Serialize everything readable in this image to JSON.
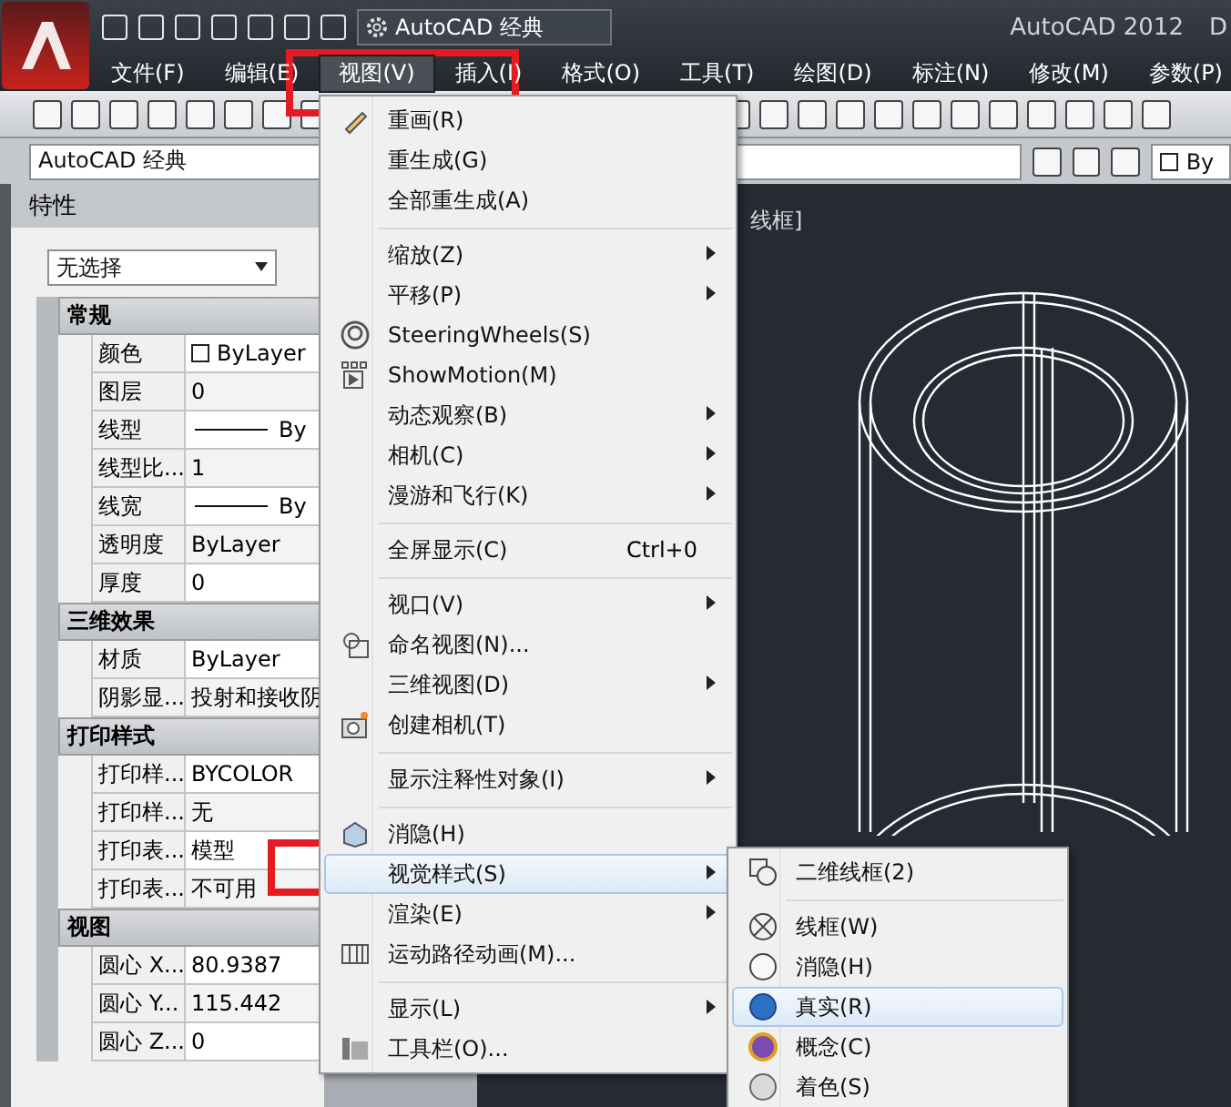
{
  "title_bar": {
    "workspace": "AutoCAD 经典",
    "app_title": "AutoCAD 2012",
    "cut_text": "D"
  },
  "menu_bar": [
    {
      "label": "文件(F)",
      "selected": false
    },
    {
      "label": "编辑(E)",
      "selected": false
    },
    {
      "label": "视图(V)",
      "selected": true
    },
    {
      "label": "插入(I)",
      "selected": false
    },
    {
      "label": "格式(O)",
      "selected": false
    },
    {
      "label": "工具(T)",
      "selected": false
    },
    {
      "label": "绘图(D)",
      "selected": false
    },
    {
      "label": "标注(N)",
      "selected": false
    },
    {
      "label": "修改(M)",
      "selected": false
    },
    {
      "label": "参数(P)",
      "selected": false
    }
  ],
  "workspace_bar": {
    "workspace": "AutoCAD 经典",
    "layer_value": "By"
  },
  "properties": {
    "title": "特性",
    "selection": "无选择",
    "sections": [
      {
        "title": "常规",
        "rows": [
          {
            "label": "颜色",
            "value": "ByLayer",
            "kind": "swatch"
          },
          {
            "label": "图层",
            "value": "0",
            "kind": "text"
          },
          {
            "label": "线型",
            "value": "By",
            "kind": "line"
          },
          {
            "label": "线型比...",
            "value": "1",
            "kind": "text"
          },
          {
            "label": "线宽",
            "value": "By",
            "kind": "line"
          },
          {
            "label": "透明度",
            "value": "ByLayer",
            "kind": "text"
          },
          {
            "label": "厚度",
            "value": "0",
            "kind": "text"
          }
        ]
      },
      {
        "title": "三维效果",
        "rows": [
          {
            "label": "材质",
            "value": "ByLayer",
            "kind": "text"
          },
          {
            "label": "阴影显...",
            "value": "投射和接收阴",
            "kind": "text"
          }
        ]
      },
      {
        "title": "打印样式",
        "rows": [
          {
            "label": "打印样...",
            "value": "BYCOLOR",
            "kind": "text"
          },
          {
            "label": "打印样...",
            "value": "无",
            "kind": "text"
          },
          {
            "label": "打印表...",
            "value": "模型",
            "kind": "text"
          },
          {
            "label": "打印表...",
            "value": "不可用",
            "kind": "text"
          }
        ]
      },
      {
        "title": "视图",
        "rows": [
          {
            "label": "圆心 X...",
            "value": "80.9387",
            "kind": "text"
          },
          {
            "label": "圆心 Y...",
            "value": "115.442",
            "kind": "text"
          },
          {
            "label": "圆心 Z...",
            "value": "0",
            "kind": "text"
          }
        ]
      }
    ]
  },
  "viewport": {
    "label": "线框]"
  },
  "view_menu": [
    {
      "kind": "item",
      "label": "重画(R)",
      "submenu": false,
      "selected": false
    },
    {
      "kind": "item",
      "label": "重生成(G)",
      "submenu": false,
      "selected": false
    },
    {
      "kind": "item",
      "label": "全部重生成(A)",
      "submenu": false,
      "selected": false
    },
    {
      "kind": "separator"
    },
    {
      "kind": "item",
      "label": "缩放(Z)",
      "submenu": true,
      "selected": false
    },
    {
      "kind": "item",
      "label": "平移(P)",
      "submenu": true,
      "selected": false
    },
    {
      "kind": "item",
      "label": "SteeringWheels(S)",
      "submenu": false,
      "selected": false
    },
    {
      "kind": "item",
      "label": "ShowMotion(M)",
      "submenu": false,
      "selected": false
    },
    {
      "kind": "item",
      "label": "动态观察(B)",
      "submenu": true,
      "selected": false
    },
    {
      "kind": "item",
      "label": "相机(C)",
      "submenu": true,
      "selected": false
    },
    {
      "kind": "item",
      "label": "漫游和飞行(K)",
      "submenu": true,
      "selected": false
    },
    {
      "kind": "separator"
    },
    {
      "kind": "item",
      "label": "全屏显示(C)",
      "shortcut": "Ctrl+0",
      "submenu": false,
      "selected": false
    },
    {
      "kind": "separator"
    },
    {
      "kind": "item",
      "label": "视口(V)",
      "submenu": true,
      "selected": false
    },
    {
      "kind": "item",
      "label": "命名视图(N)...",
      "submenu": false,
      "selected": false
    },
    {
      "kind": "item",
      "label": "三维视图(D)",
      "submenu": true,
      "selected": false
    },
    {
      "kind": "item",
      "label": "创建相机(T)",
      "submenu": false,
      "selected": false
    },
    {
      "kind": "separator"
    },
    {
      "kind": "item",
      "label": "显示注释性对象(I)",
      "submenu": true,
      "selected": false
    },
    {
      "kind": "separator"
    },
    {
      "kind": "item",
      "label": "消隐(H)",
      "submenu": false,
      "selected": false
    },
    {
      "kind": "item",
      "label": "视觉样式(S)",
      "submenu": true,
      "selected": true
    },
    {
      "kind": "item",
      "label": "渲染(E)",
      "submenu": true,
      "selected": false
    },
    {
      "kind": "item",
      "label": "运动路径动画(M)...",
      "submenu": false,
      "selected": false
    },
    {
      "kind": "separator"
    },
    {
      "kind": "item",
      "label": "显示(L)",
      "submenu": true,
      "selected": false
    },
    {
      "kind": "item",
      "label": "工具栏(O)...",
      "submenu": false,
      "selected": false
    }
  ],
  "visual_styles_menu": [
    {
      "kind": "item",
      "label": "二维线框(2)",
      "selected": false
    },
    {
      "kind": "separator"
    },
    {
      "kind": "item",
      "label": "线框(W)",
      "selected": false
    },
    {
      "kind": "item",
      "label": "消隐(H)",
      "selected": false
    },
    {
      "kind": "item",
      "label": "真实(R)",
      "selected": true
    },
    {
      "kind": "item",
      "label": "概念(C)",
      "selected": false
    },
    {
      "kind": "item",
      "label": "着色(S)",
      "selected": false
    }
  ]
}
